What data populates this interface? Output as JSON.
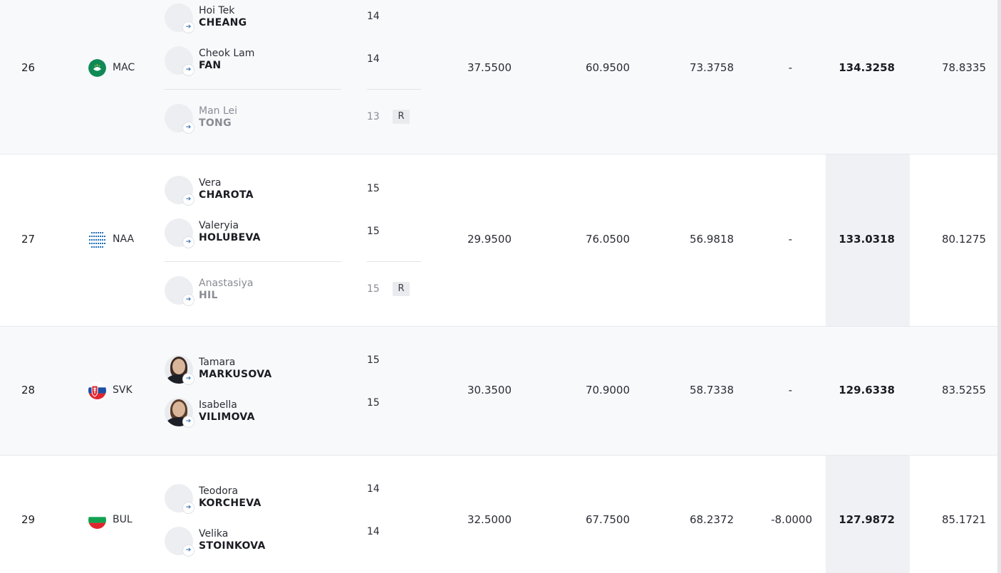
{
  "rows": [
    {
      "rank": "26",
      "noc": "MAC",
      "athletes": [
        {
          "given": "Hoi Tek",
          "family": "CHEANG",
          "age": "14"
        },
        {
          "given": "Cheok Lam",
          "family": "FAN",
          "age": "14"
        },
        {
          "given": "Man Lei",
          "family": "TONG",
          "age": "13",
          "tag": "R"
        }
      ],
      "d": "37.5500",
      "e": "60.9500",
      "sa": "73.3758",
      "pen": "-",
      "total": "134.3258",
      "last": "78.8335"
    },
    {
      "rank": "27",
      "noc": "NAA",
      "athletes": [
        {
          "given": "Vera",
          "family": "CHAROTA",
          "age": "15"
        },
        {
          "given": "Valeryia",
          "family": "HOLUBEVA",
          "age": "15"
        },
        {
          "given": "Anastasiya",
          "family": "HIL",
          "age": "15",
          "tag": "R"
        }
      ],
      "d": "29.9500",
      "e": "76.0500",
      "sa": "56.9818",
      "pen": "-",
      "total": "133.0318",
      "last": "80.1275"
    },
    {
      "rank": "28",
      "noc": "SVK",
      "athletes": [
        {
          "given": "Tamara",
          "family": "MARKUSOVA",
          "age": "15"
        },
        {
          "given": "Isabella",
          "family": "VILIMOVA",
          "age": "15"
        }
      ],
      "d": "30.3500",
      "e": "70.9000",
      "sa": "58.7338",
      "pen": "-",
      "total": "129.6338",
      "last": "83.5255"
    },
    {
      "rank": "29",
      "noc": "BUL",
      "athletes": [
        {
          "given": "Teodora",
          "family": "KORCHEVA",
          "age": "14"
        },
        {
          "given": "Velika",
          "family": "STOINKOVA",
          "age": "14"
        }
      ],
      "d": "32.5000",
      "e": "67.7500",
      "sa": "68.2372",
      "pen": "-8.0000",
      "total": "127.9872",
      "last": "85.1721"
    }
  ],
  "icons": {
    "profile_link": "arrow-right-icon"
  },
  "colors": {
    "alt_row": "#f8f9fb",
    "total_band": "#f0f1f4",
    "link_arrow": "#3a71b8"
  }
}
